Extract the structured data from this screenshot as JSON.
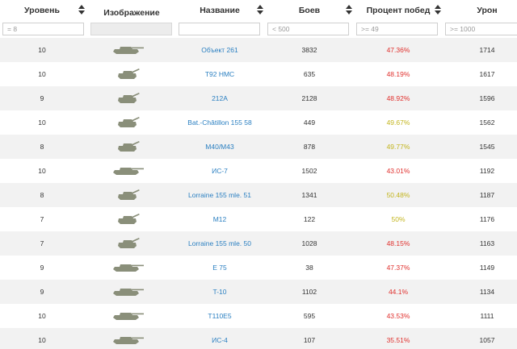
{
  "columns": [
    {
      "key": "tier",
      "label": "Уровень",
      "sortable": true,
      "filter_placeholder": "= 8"
    },
    {
      "key": "image",
      "label": "Изображение",
      "sortable": false,
      "filter_placeholder": ""
    },
    {
      "key": "name",
      "label": "Название",
      "sortable": true,
      "filter_placeholder": ""
    },
    {
      "key": "battles",
      "label": "Боев",
      "sortable": true,
      "filter_placeholder": "< 500"
    },
    {
      "key": "winrate",
      "label": "Процент побед",
      "sortable": true,
      "filter_placeholder": ">= 49"
    },
    {
      "key": "damage",
      "label": "Урон",
      "sortable": false,
      "filter_placeholder": ">= 1000"
    }
  ],
  "colors": {
    "link": "#2a7fc1",
    "winrate_red": "#e0312e",
    "winrate_yellow": "#c3b51e",
    "tank_icon": "#8a8f7a",
    "row_stripe": "#f2f2f2"
  },
  "rows": [
    {
      "tier": "10",
      "icon": "tank-heavy-icon",
      "name": "Объект 261",
      "battles": "3832",
      "winrate": "47.36%",
      "rate_level": "red",
      "damage": "1714"
    },
    {
      "tier": "10",
      "icon": "spg-icon",
      "name": "T92 HMC",
      "battles": "635",
      "winrate": "48.19%",
      "rate_level": "red",
      "damage": "1617"
    },
    {
      "tier": "9",
      "icon": "spg-icon",
      "name": "212A",
      "battles": "2128",
      "winrate": "48.92%",
      "rate_level": "red",
      "damage": "1596"
    },
    {
      "tier": "10",
      "icon": "spg-icon",
      "name": "Bat.-Châtillon 155 58",
      "battles": "449",
      "winrate": "49.67%",
      "rate_level": "yellow",
      "damage": "1562"
    },
    {
      "tier": "8",
      "icon": "spg-icon",
      "name": "M40/M43",
      "battles": "878",
      "winrate": "49.77%",
      "rate_level": "yellow",
      "damage": "1545"
    },
    {
      "tier": "10",
      "icon": "tank-heavy-icon",
      "name": "ИС-7",
      "battles": "1502",
      "winrate": "43.01%",
      "rate_level": "red",
      "damage": "1192"
    },
    {
      "tier": "8",
      "icon": "spg-icon",
      "name": "Lorraine 155 mle. 51",
      "battles": "1341",
      "winrate": "50.48%",
      "rate_level": "yellow",
      "damage": "1187"
    },
    {
      "tier": "7",
      "icon": "spg-icon",
      "name": "M12",
      "battles": "122",
      "winrate": "50%",
      "rate_level": "yellow",
      "damage": "1176"
    },
    {
      "tier": "7",
      "icon": "spg-icon",
      "name": "Lorraine 155 mle. 50",
      "battles": "1028",
      "winrate": "48.15%",
      "rate_level": "red",
      "damage": "1163"
    },
    {
      "tier": "9",
      "icon": "tank-heavy-icon",
      "name": "E 75",
      "battles": "38",
      "winrate": "47.37%",
      "rate_level": "red",
      "damage": "1149"
    },
    {
      "tier": "9",
      "icon": "tank-heavy-icon",
      "name": "T-10",
      "battles": "1102",
      "winrate": "44.1%",
      "rate_level": "red",
      "damage": "1134"
    },
    {
      "tier": "10",
      "icon": "tank-heavy-icon",
      "name": "T110E5",
      "battles": "595",
      "winrate": "43.53%",
      "rate_level": "red",
      "damage": "1111"
    },
    {
      "tier": "10",
      "icon": "tank-heavy-icon",
      "name": "ИС-4",
      "battles": "107",
      "winrate": "35.51%",
      "rate_level": "red",
      "damage": "1057"
    }
  ]
}
